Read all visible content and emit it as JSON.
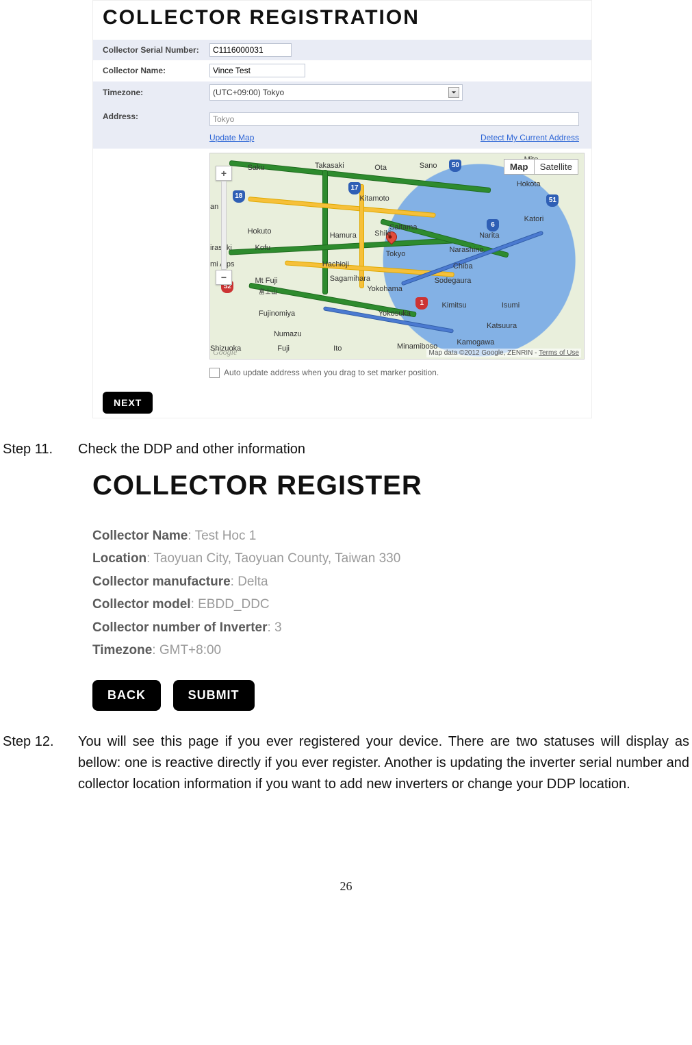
{
  "shot1": {
    "title": "COLLECTOR REGISTRATION",
    "serial_label": "Collector Serial Number:",
    "serial_value": "C1116000031",
    "name_label": "Collector Name:",
    "name_value": "Vince Test",
    "tz_label": "Timezone:",
    "tz_value": "(UTC+09:00) Tokyo",
    "addr_label": "Address:",
    "addr_value": "Tokyo",
    "update_map": "Update Map",
    "detect_addr": "Detect My Current Address",
    "map_btn": "Map",
    "sat_btn": "Satellite",
    "zoom_in": "+",
    "zoom_out": "−",
    "attrib": "Map data ©2012 Google, ZENRIN - ",
    "terms": "Terms of Use",
    "google": "Google",
    "auto_update": "Auto update address when you drag to set marker position.",
    "next": "NEXT",
    "cities": {
      "saku": "Saku",
      "takasaki": "Takasaki",
      "ota": "Ota",
      "sano": "Sano",
      "mito": "Mito",
      "hokota": "Hokota",
      "kitamoto": "Kitamoto",
      "katori": "Katori",
      "hokuto": "Hokuto",
      "saitama": "Saitama",
      "narita": "Narita",
      "hamura": "Hamura",
      "shiki": "Shiki",
      "irasaki": "irasaki",
      "kofu": "Kofu",
      "tokyo": "Tokyo",
      "narashino": "Narashino",
      "alps": "mi Alps",
      "hachioji": "Hachioji",
      "chiba": "Chiba",
      "mtfuji": "Mt Fuji",
      "fujisan": "富士山",
      "sagamihara": "Sagamihara",
      "sodegaura": "Sodegaura",
      "yokohama": "Yokohama",
      "fujinomiya": "Fujinomiya",
      "yokosuka": "Yokosuka",
      "kimitsu": "Kimitsu",
      "isumi": "Isumi",
      "numazu": "Numazu",
      "katsuura": "Katsuura",
      "shizuoka": "Shizuoka",
      "fuji": "Fuji",
      "ito": "Ito",
      "minamiboso": "Minamiboso",
      "kamogawa": "Kamogawa",
      "an": "an"
    },
    "shields": {
      "s18": "18",
      "s50": "50",
      "s17": "17",
      "s51": "51",
      "s6": "6",
      "s52": "52",
      "s1": "1"
    }
  },
  "step11": {
    "num": "Step 11.",
    "text": "Check the DDP and other information"
  },
  "shot2": {
    "title": "COLLECTOR REGISTER",
    "lines": {
      "name_l": "Collector Name",
      "name_v": ": Test Hoc 1",
      "loc_l": "Location",
      "loc_v": ": Taoyuan City, Taoyuan County, Taiwan 330",
      "manu_l": "Collector manufacture",
      "manu_v": ": Delta",
      "model_l": "Collector model",
      "model_v": ": EBDD_DDC",
      "inv_l": "Collector number of Inverter",
      "inv_v": ": 3",
      "tz_l": "Timezone",
      "tz_v": ": GMT+8:00"
    },
    "back": "BACK",
    "submit": "SUBMIT"
  },
  "step12": {
    "num": "Step 12.",
    "text": "You will see this page if you ever registered your device. There are two statuses will display as bellow: one is reactive directly if you ever register. Another is updating the inverter serial number and collector location information if you want to add new inverters or change your DDP location."
  },
  "pagenum": "26"
}
